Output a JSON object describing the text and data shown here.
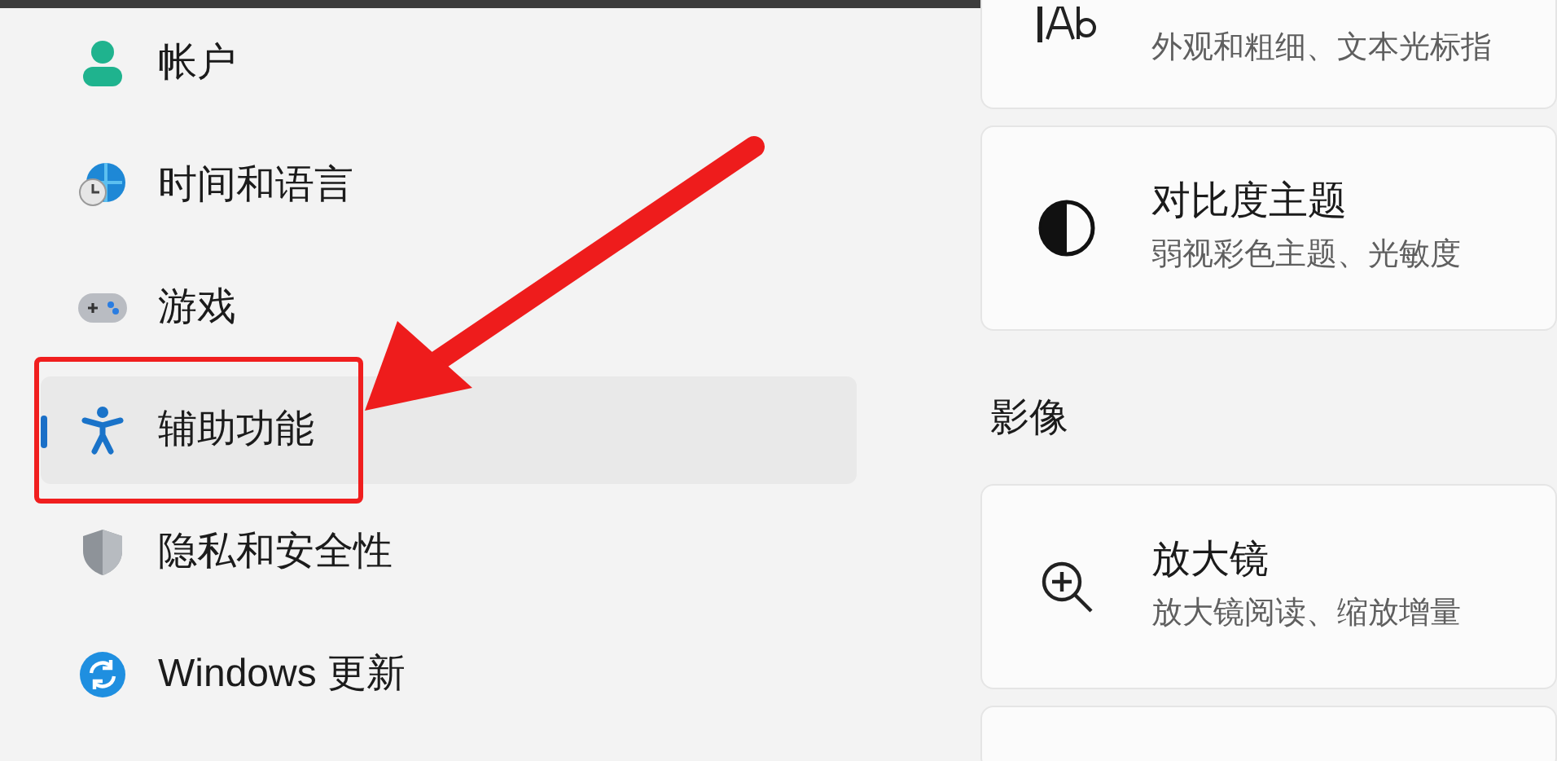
{
  "sidebar": {
    "items": [
      {
        "kind": "account",
        "label": "帐户",
        "selected": false
      },
      {
        "kind": "time",
        "label": "时间和语言",
        "selected": false
      },
      {
        "kind": "gaming",
        "label": "游戏",
        "selected": false
      },
      {
        "kind": "accessibility",
        "label": "辅助功能",
        "selected": true
      },
      {
        "kind": "privacy",
        "label": "隐私和安全性",
        "selected": false
      },
      {
        "kind": "update",
        "label": "Windows 更新",
        "selected": false
      }
    ]
  },
  "top_cards": [
    {
      "kind": "text-cursor",
      "description": "外观和粗细、文本光标指"
    },
    {
      "kind": "contrast",
      "title": "对比度主题",
      "description": "弱视彩色主题、光敏度"
    }
  ],
  "section": {
    "heading": "影像",
    "cards": [
      {
        "kind": "magnifier",
        "title": "放大镜",
        "description": "放大镜阅读、缩放增量"
      }
    ]
  },
  "annotations": {
    "highlight_frame": true,
    "arrow": true
  }
}
